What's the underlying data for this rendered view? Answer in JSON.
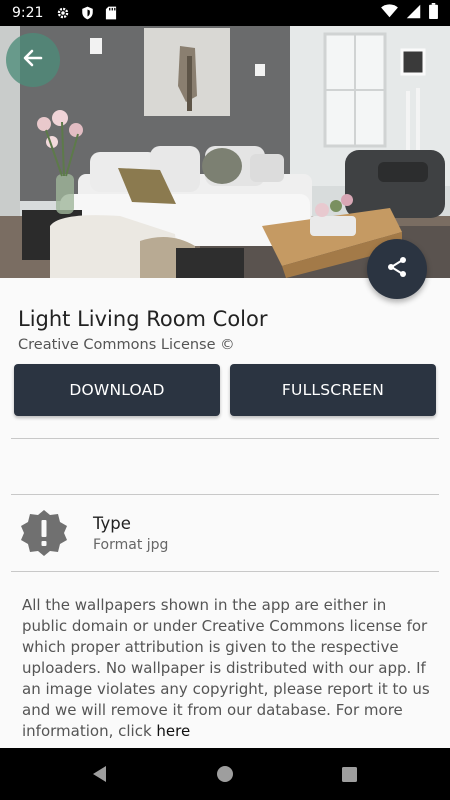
{
  "status_bar": {
    "time": "9:21",
    "left_icons": [
      "settings-icon",
      "shield-icon",
      "sd-card-icon"
    ],
    "right_icons": [
      "wifi-icon",
      "signal-icon",
      "battery-icon"
    ]
  },
  "hero": {
    "image": "living-room-photo",
    "back_icon": "arrow-left-icon",
    "share_icon": "share-icon"
  },
  "wallpaper": {
    "title": "Light Living Room Color",
    "license": "Creative Commons License ©"
  },
  "actions": {
    "download_label": "DOWNLOAD",
    "fullscreen_label": "FULLSCREEN"
  },
  "info": {
    "icon": "alert-badge-icon",
    "label": "Type",
    "value": "Format jpg"
  },
  "disclaimer": {
    "text": "All the wallpapers shown in the app are either in public domain or under Creative Commons license for which proper attribution is given to the respective uploaders. No wallpaper is distributed with our app. If an image violates any copyright, please report it to us and we will remove it from our database. For more information, click ",
    "link_text": "here"
  },
  "nav_bar": {
    "icons": [
      "back-triangle-icon",
      "home-circle-icon",
      "recents-square-icon"
    ]
  },
  "colors": {
    "primary": "#2b3441",
    "back_button": "#4d8c78",
    "background": "#fafafa"
  }
}
